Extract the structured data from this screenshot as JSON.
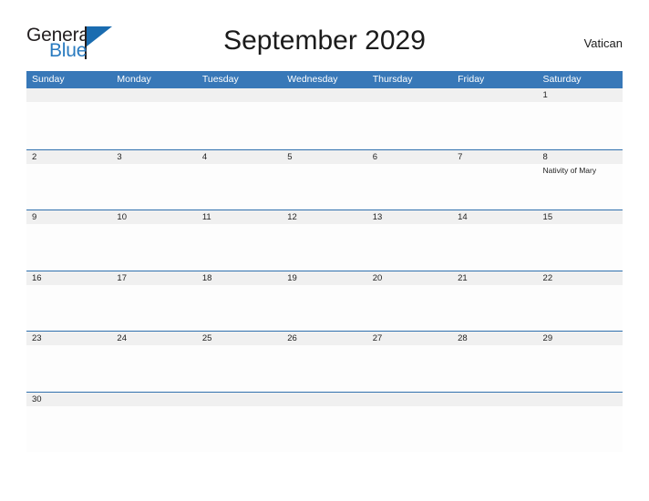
{
  "brand": {
    "name_part1": "General",
    "name_part2": "Blue",
    "flag_icon": "flag-triangle-icon"
  },
  "header": {
    "title": "September 2029",
    "locale": "Vatican"
  },
  "calendar": {
    "weekdays": [
      "Sunday",
      "Monday",
      "Tuesday",
      "Wednesday",
      "Thursday",
      "Friday",
      "Saturday"
    ],
    "colors": {
      "header_blue": "#3878b8",
      "row_line_blue": "#2f6fad",
      "daynum_band": "#f0f0f0",
      "brand_blue": "#2a7bc0",
      "text": "#222222"
    },
    "weeks": [
      {
        "days": [
          {
            "num": "",
            "events": []
          },
          {
            "num": "",
            "events": []
          },
          {
            "num": "",
            "events": []
          },
          {
            "num": "",
            "events": []
          },
          {
            "num": "",
            "events": []
          },
          {
            "num": "",
            "events": []
          },
          {
            "num": "1",
            "events": []
          }
        ]
      },
      {
        "days": [
          {
            "num": "2",
            "events": []
          },
          {
            "num": "3",
            "events": []
          },
          {
            "num": "4",
            "events": []
          },
          {
            "num": "5",
            "events": []
          },
          {
            "num": "6",
            "events": []
          },
          {
            "num": "7",
            "events": []
          },
          {
            "num": "8",
            "events": [
              "Nativity of Mary"
            ]
          }
        ]
      },
      {
        "days": [
          {
            "num": "9",
            "events": []
          },
          {
            "num": "10",
            "events": []
          },
          {
            "num": "11",
            "events": []
          },
          {
            "num": "12",
            "events": []
          },
          {
            "num": "13",
            "events": []
          },
          {
            "num": "14",
            "events": []
          },
          {
            "num": "15",
            "events": []
          }
        ]
      },
      {
        "days": [
          {
            "num": "16",
            "events": []
          },
          {
            "num": "17",
            "events": []
          },
          {
            "num": "18",
            "events": []
          },
          {
            "num": "19",
            "events": []
          },
          {
            "num": "20",
            "events": []
          },
          {
            "num": "21",
            "events": []
          },
          {
            "num": "22",
            "events": []
          }
        ]
      },
      {
        "days": [
          {
            "num": "23",
            "events": []
          },
          {
            "num": "24",
            "events": []
          },
          {
            "num": "25",
            "events": []
          },
          {
            "num": "26",
            "events": []
          },
          {
            "num": "27",
            "events": []
          },
          {
            "num": "28",
            "events": []
          },
          {
            "num": "29",
            "events": []
          }
        ]
      },
      {
        "days": [
          {
            "num": "30",
            "events": []
          },
          {
            "num": "",
            "events": []
          },
          {
            "num": "",
            "events": []
          },
          {
            "num": "",
            "events": []
          },
          {
            "num": "",
            "events": []
          },
          {
            "num": "",
            "events": []
          },
          {
            "num": "",
            "events": []
          }
        ]
      }
    ]
  }
}
